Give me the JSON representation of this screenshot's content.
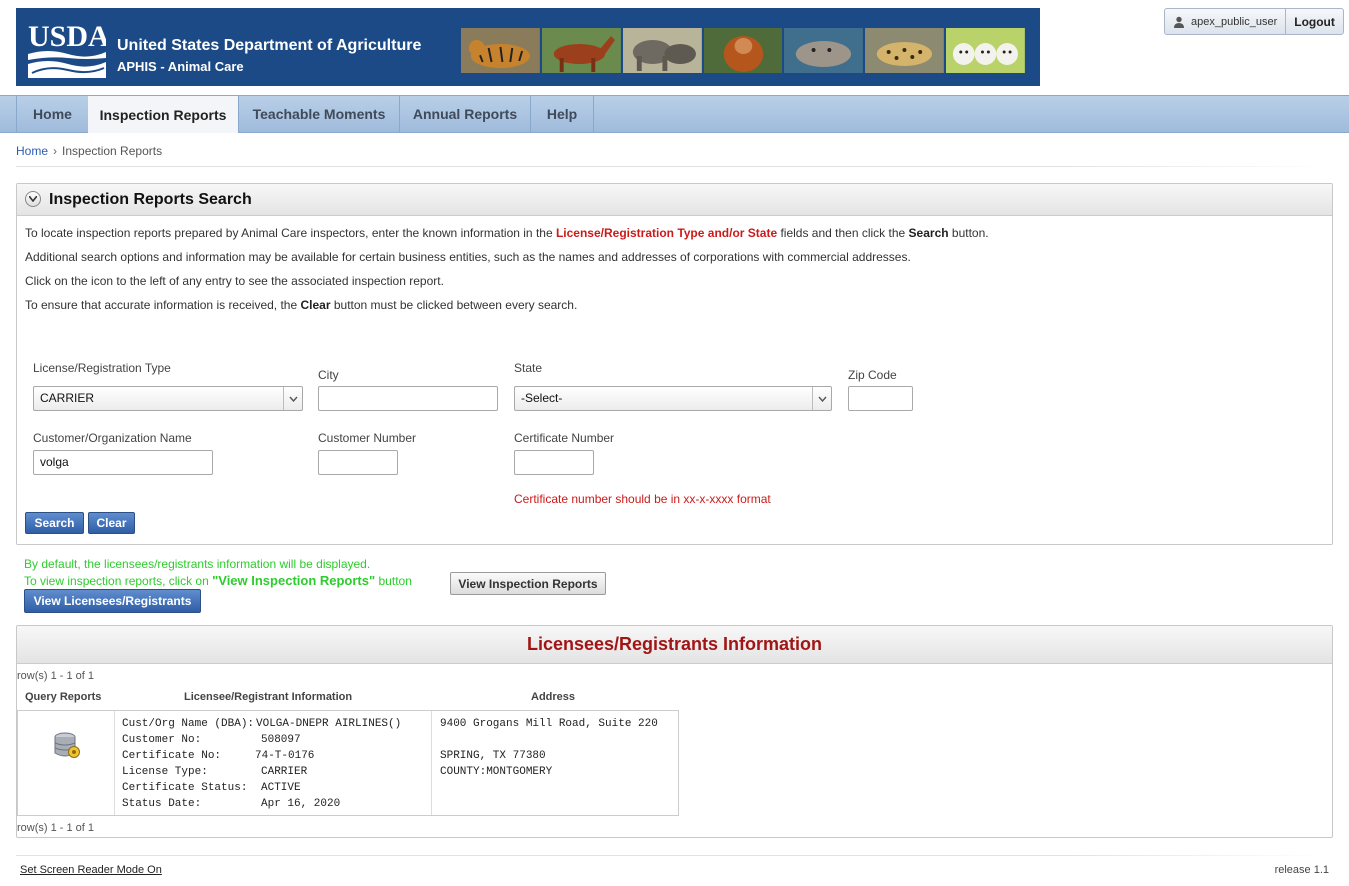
{
  "header": {
    "logo_text": "USDA",
    "title": "United States Department of Agriculture",
    "subtitle": "APHIS - Animal Care",
    "animals": [
      "tiger-image",
      "horses-image",
      "elephants-image",
      "orangutan-image",
      "seal-image",
      "leopard-image",
      "puppies-image"
    ]
  },
  "user": {
    "name": "apex_public_user",
    "logout_label": "Logout"
  },
  "nav": {
    "tabs": [
      {
        "label": "Home",
        "active": false
      },
      {
        "label": "Inspection Reports",
        "active": true
      },
      {
        "label": "Teachable Moments",
        "active": false
      },
      {
        "label": "Annual Reports",
        "active": false
      },
      {
        "label": "Help",
        "active": false
      }
    ]
  },
  "breadcrumb": {
    "home": "Home",
    "current": "Inspection Reports"
  },
  "search": {
    "title": "Inspection Reports Search",
    "instructions": {
      "line1_pre": "To locate inspection reports prepared by Animal Care inspectors, enter the known information in the ",
      "line1_highlight": "License/Registration Type and/or State",
      "line1_mid": " fields and then click the ",
      "line1_bold": "Search",
      "line1_post": " button.",
      "line2": "Additional search options and information may be available for certain business entities, such as the names and addresses of corporations with commercial addresses.",
      "line3": "Click on the icon to the left of any entry to see the associated inspection report.",
      "line4_pre": "To ensure that accurate information is received, the ",
      "line4_bold": "Clear",
      "line4_post": " button must be clicked between every search."
    },
    "fields": {
      "license_type": {
        "label": "License/Registration Type",
        "value": "CARRIER"
      },
      "city": {
        "label": "City",
        "value": ""
      },
      "state": {
        "label": "State",
        "value": "-Select-"
      },
      "zip": {
        "label": "Zip Code",
        "value": ""
      },
      "customer_name": {
        "label": "Customer/Organization Name",
        "value": "volga"
      },
      "customer_number": {
        "label": "Customer Number",
        "value": ""
      },
      "certificate_number": {
        "label": "Certificate Number",
        "value": ""
      }
    },
    "cert_error": "Certificate number should be in xx-x-xxxx format",
    "search_label": "Search",
    "clear_label": "Clear"
  },
  "view": {
    "note1": "By default, the licensees/registrants information will be displayed.",
    "note2_pre": "To view inspection reports, click on ",
    "note2_bold": "\"View Inspection Reports\"",
    "note2_post": " button",
    "view_licensees_label": "View Licensees/Registrants",
    "view_reports_label": "View Inspection Reports"
  },
  "results": {
    "title": "Licensees/Registrants Information",
    "rowcount_top": "row(s) 1 - 1 of 1",
    "rowcount_bottom": "row(s) 1 - 1 of 1",
    "columns": [
      "Query Reports",
      "Licensee/Registrant Information",
      "Address"
    ],
    "row": {
      "info": [
        {
          "key": "Cust/Org Name (DBA):",
          "value": "VOLGA-DNEPR AIRLINES()"
        },
        {
          "key": "Customer No:",
          "value": "508097"
        },
        {
          "key": "Certificate No:",
          "value": "74-T-0176"
        },
        {
          "key": "License Type:",
          "value": "CARRIER"
        },
        {
          "key": "Certificate Status:",
          "value": "ACTIVE"
        },
        {
          "key": "Status Date:",
          "value": "Apr 16, 2020"
        }
      ],
      "address": [
        "9400 Grogans Mill Road, Suite 220",
        "",
        "SPRING, TX 77380",
        "COUNTY:MONTGOMERY"
      ]
    }
  },
  "footer": {
    "screen_reader": "Set Screen Reader Mode On",
    "release": "release 1.1"
  },
  "colors": {
    "banner": "#1b4a86",
    "accent_red": "#cc1a1a",
    "green": "#2ecc2e",
    "button_blue": "#2f5ea6"
  }
}
